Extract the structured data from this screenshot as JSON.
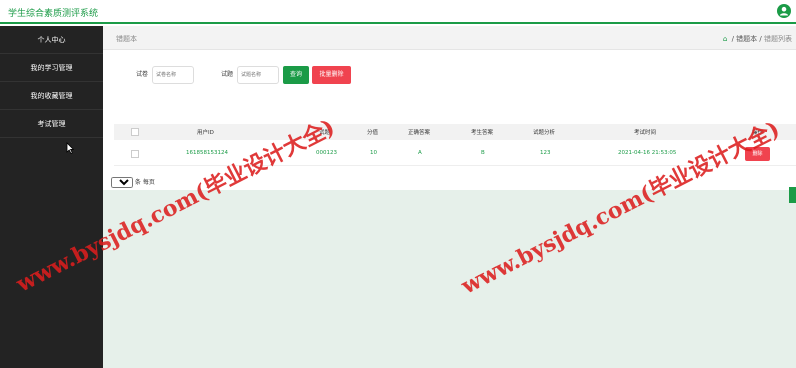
{
  "app": {
    "title": "学生综合素质测评系统"
  },
  "sidebar": {
    "items": [
      {
        "label": "个人中心"
      },
      {
        "label": "我的学习管理"
      },
      {
        "label": "我的收藏管理"
      },
      {
        "label": "考试管理"
      }
    ]
  },
  "breadcrumb": {
    "title": "错题本",
    "path_mid": "错题本",
    "path_current": "错题列表"
  },
  "search": {
    "paper_label": "试卷",
    "paper_placeholder": "试卷名称",
    "question_label": "试题",
    "question_placeholder": "试题名称",
    "search_button": "查询",
    "batch_delete_button": "批量删除"
  },
  "table": {
    "columns": [
      "用户ID",
      "试卷",
      "试题",
      "分值",
      "正确答案",
      "考生答案",
      "试题分析",
      "考试时间",
      "操作"
    ],
    "rows": [
      {
        "user_id": "161858153124",
        "paper": "000123",
        "score": "10",
        "correct": "A",
        "answer": "B",
        "analysis": "123",
        "time": "2021-04-16 21:53:05",
        "action": "删除"
      }
    ]
  },
  "pager": {
    "page_size": "10",
    "suffix": "条 每页"
  },
  "watermark": {
    "text": "www.bysjdq.com(毕业设计大全)"
  },
  "colors": {
    "primary": "#1b9b47",
    "danger": "#f0434f",
    "sidebar": "#232323"
  }
}
